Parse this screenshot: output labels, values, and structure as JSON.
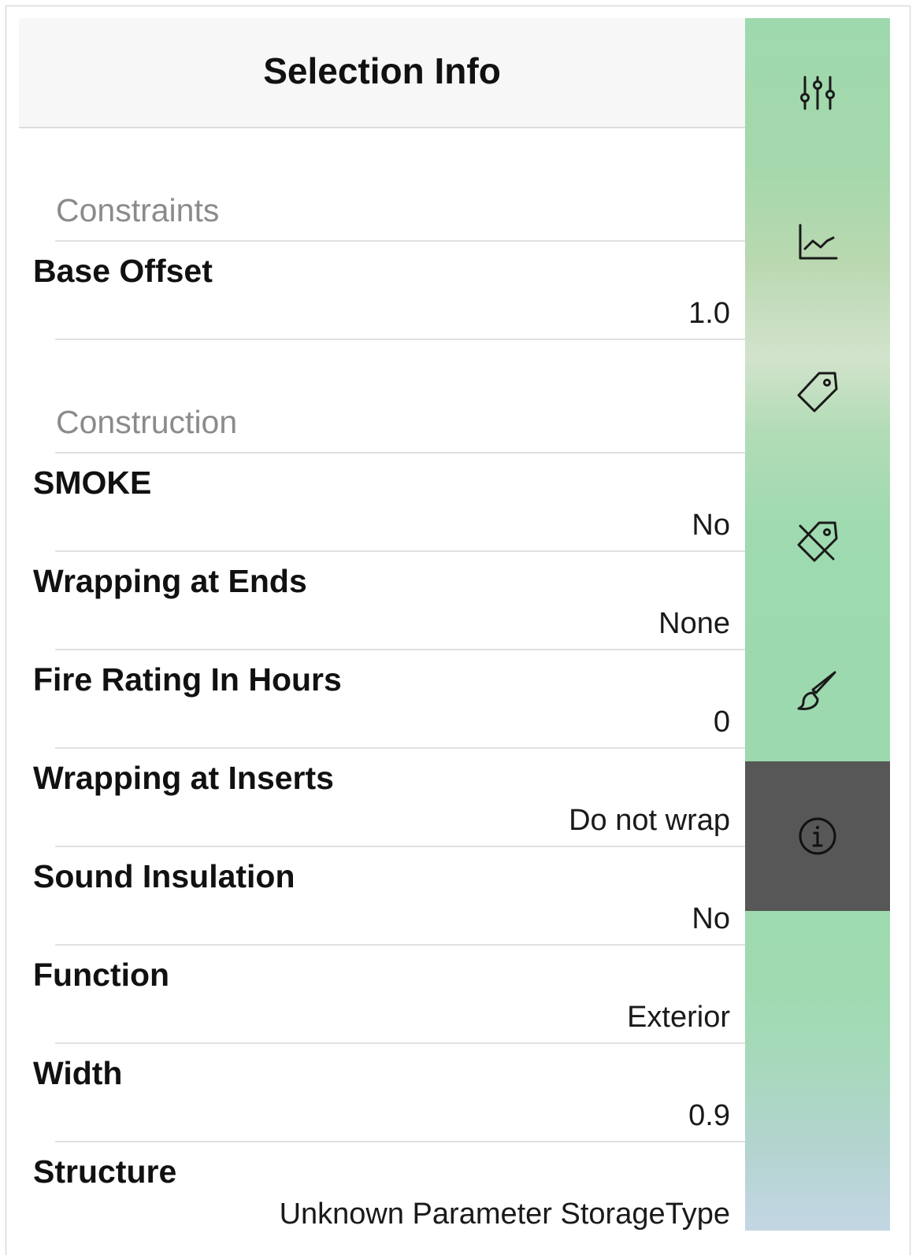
{
  "header": {
    "title": "Selection Info"
  },
  "sections": [
    {
      "title": "Constraints",
      "rows": [
        {
          "label": "Base Offset",
          "value": "1.0"
        }
      ]
    },
    {
      "title": "Construction",
      "rows": [
        {
          "label": "SMOKE",
          "value": "No"
        },
        {
          "label": "Wrapping at Ends",
          "value": "None"
        },
        {
          "label": "Fire Rating In Hours",
          "value": "0"
        },
        {
          "label": "Wrapping at Inserts",
          "value": "Do not wrap"
        },
        {
          "label": "Sound Insulation",
          "value": "No"
        },
        {
          "label": "Function",
          "value": "Exterior"
        },
        {
          "label": "Width",
          "value": "0.9"
        },
        {
          "label": "Structure",
          "value": "Unknown Parameter StorageType"
        }
      ]
    }
  ],
  "toolbar": {
    "items": [
      {
        "icon": "sliders-icon",
        "active": false
      },
      {
        "icon": "chart-icon",
        "active": false
      },
      {
        "icon": "tag-icon",
        "active": false
      },
      {
        "icon": "untag-icon",
        "active": false
      },
      {
        "icon": "brush-icon",
        "active": false
      },
      {
        "icon": "info-icon",
        "active": true
      }
    ],
    "active_color": "#575757",
    "accent_color": "#9ed9ad"
  }
}
